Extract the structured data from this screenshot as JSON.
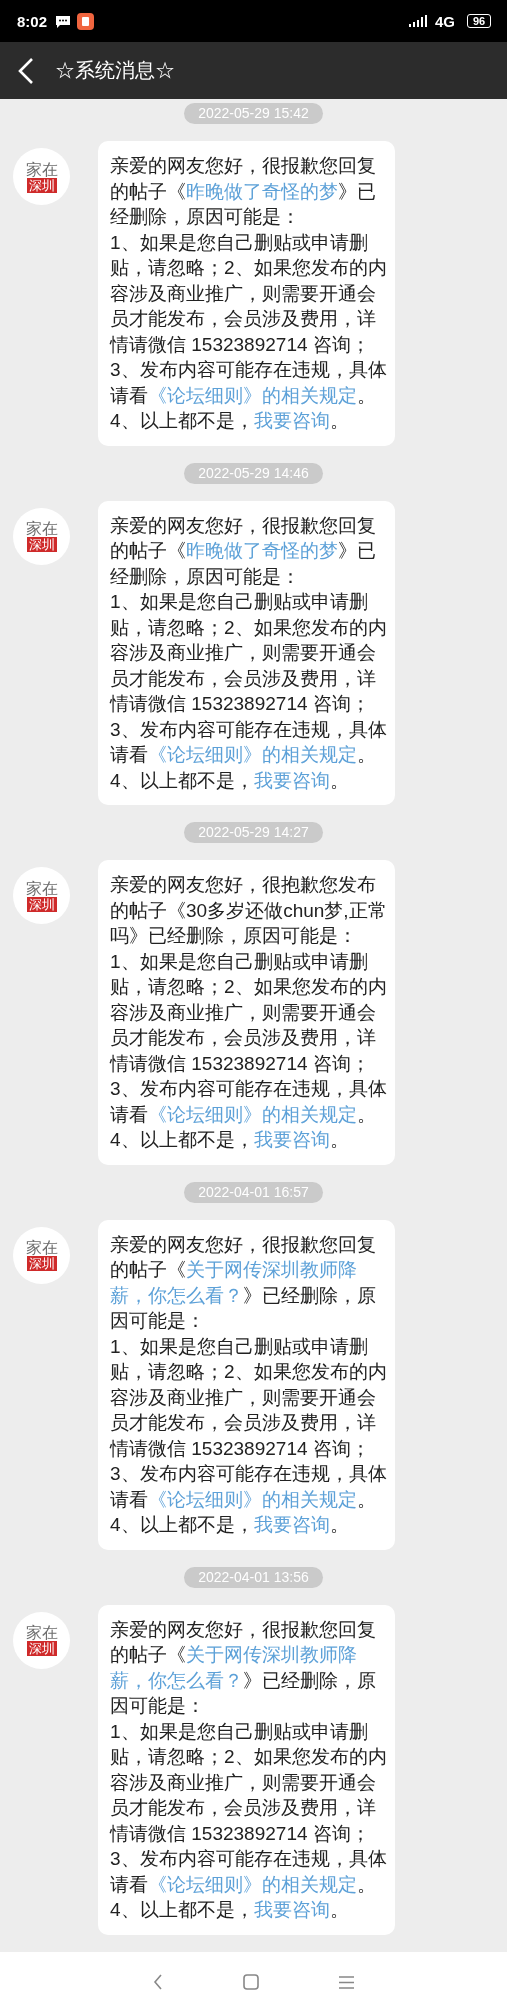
{
  "status_bar": {
    "time": "8:02",
    "network": "4G",
    "battery": "96"
  },
  "header": {
    "title": "☆系统消息☆"
  },
  "messages": [
    {
      "time": "2022-05-29 15:42",
      "avatar": {
        "top": "家在",
        "bottom": "深圳"
      },
      "segments": [
        {
          "kind": "text",
          "text": "亲爱的网友您好，很报歉您回复的帖子《"
        },
        {
          "kind": "link",
          "text": "昨晚做了奇怪的梦"
        },
        {
          "kind": "text",
          "text": "》已经删除，原因可能是：\n1、如果是您自己删贴或申请删贴，请忽略；2、如果您发布的内容涉及商业推广，则需要开通会员才能发布，会员涉及费用，详情请微信 15323892714 咨询；\n3、发布内容可能存在违规，具体请看"
        },
        {
          "kind": "link",
          "text": "《论坛细则》的相关规定"
        },
        {
          "kind": "text",
          "text": "。\n4、以上都不是，"
        },
        {
          "kind": "link",
          "text": "我要咨询"
        },
        {
          "kind": "text",
          "text": "。"
        }
      ]
    },
    {
      "time": "2022-05-29 14:46",
      "avatar": {
        "top": "家在",
        "bottom": "深圳"
      },
      "segments": [
        {
          "kind": "text",
          "text": "亲爱的网友您好，很报歉您回复的帖子《"
        },
        {
          "kind": "link",
          "text": "昨晚做了奇怪的梦"
        },
        {
          "kind": "text",
          "text": "》已经删除，原因可能是：\n1、如果是您自己删贴或申请删贴，请忽略；2、如果您发布的内容涉及商业推广，则需要开通会员才能发布，会员涉及费用，详情请微信 15323892714 咨询；\n3、发布内容可能存在违规，具体请看"
        },
        {
          "kind": "link",
          "text": "《论坛细则》的相关规定"
        },
        {
          "kind": "text",
          "text": "。\n4、以上都不是，"
        },
        {
          "kind": "link",
          "text": "我要咨询"
        },
        {
          "kind": "text",
          "text": "。"
        }
      ]
    },
    {
      "time": "2022-05-29 14:27",
      "avatar": {
        "top": "家在",
        "bottom": "深圳"
      },
      "segments": [
        {
          "kind": "text",
          "text": "亲爱的网友您好，很抱歉您发布的帖子《30多岁还做chun梦,正常吗》已经删除，原因可能是：\n1、如果是您自己删贴或申请删贴，请忽略；2、如果您发布的内容涉及商业推广，则需要开通会员才能发布，会员涉及费用，详情请微信 15323892714 咨询；\n3、发布内容可能存在违规，具体请看"
        },
        {
          "kind": "link",
          "text": "《论坛细则》的相关规定"
        },
        {
          "kind": "text",
          "text": "。\n4、以上都不是，"
        },
        {
          "kind": "link",
          "text": "我要咨询"
        },
        {
          "kind": "text",
          "text": "。"
        }
      ]
    },
    {
      "time": "2022-04-01 16:57",
      "avatar": {
        "top": "家在",
        "bottom": "深圳"
      },
      "segments": [
        {
          "kind": "text",
          "text": "亲爱的网友您好，很报歉您回复的帖子《"
        },
        {
          "kind": "link",
          "text": "关于网传深圳教师降"
        },
        {
          "kind": "link",
          "text": "薪，你怎么看？"
        },
        {
          "kind": "text",
          "text": "》已经删除，原因可能是：\n1、如果是您自己删贴或申请删贴，请忽略；2、如果您发布的内容涉及商业推广，则需要开通会员才能发布，会员涉及费用，详情请微信 15323892714 咨询；\n3、发布内容可能存在违规，具体请看"
        },
        {
          "kind": "link",
          "text": "《论坛细则》的相关规定"
        },
        {
          "kind": "text",
          "text": "。\n4、以上都不是，"
        },
        {
          "kind": "link",
          "text": "我要咨询"
        },
        {
          "kind": "text",
          "text": "。"
        }
      ]
    },
    {
      "time": "2022-04-01 13:56",
      "avatar": {
        "top": "家在",
        "bottom": "深圳"
      },
      "segments": [
        {
          "kind": "text",
          "text": "亲爱的网友您好，很报歉您回复的帖子《"
        },
        {
          "kind": "link",
          "text": "关于网传深圳教师降"
        },
        {
          "kind": "link",
          "text": "薪，你怎么看？"
        },
        {
          "kind": "text",
          "text": "》已经删除，原因可能是：\n1、如果是您自己删贴或申请删贴，请忽略；2、如果您发布的内容涉及商业推广，则需要开通会员才能发布，会员涉及费用，详情请微信 15323892714 咨询；\n3、发布内容可能存在违规，具体请看"
        },
        {
          "kind": "link",
          "text": "《论坛细则》的相关规定"
        },
        {
          "kind": "text",
          "text": "。\n4、以上都不是，"
        },
        {
          "kind": "link",
          "text": "我要咨询"
        },
        {
          "kind": "text",
          "text": "。"
        }
      ]
    }
  ]
}
